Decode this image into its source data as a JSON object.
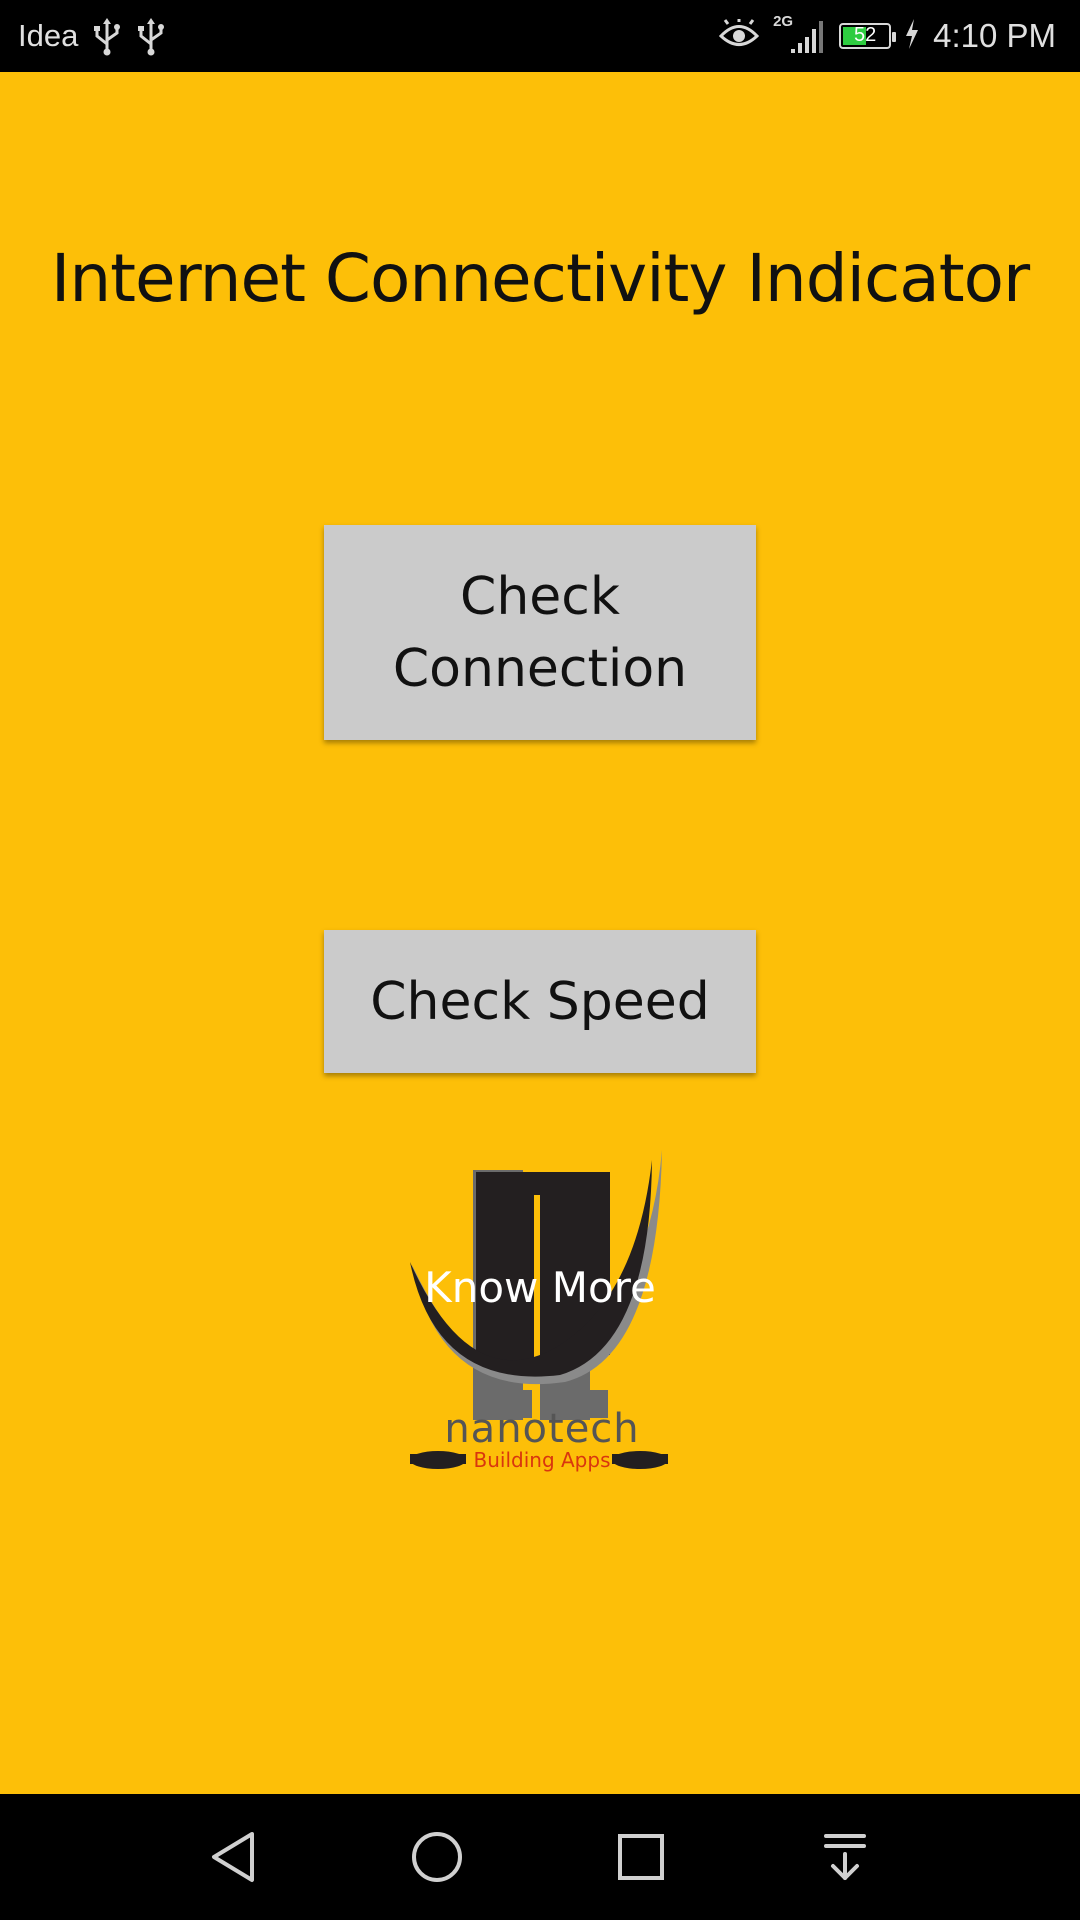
{
  "status_bar": {
    "carrier": "Idea",
    "network_type": "2G",
    "battery_level": "52",
    "battery_fraction": 0.52,
    "time": "4:10 PM",
    "icons": [
      "usb-icon",
      "usb-icon",
      "eye-icon",
      "signal-icon",
      "battery-icon",
      "charging-icon"
    ]
  },
  "main": {
    "title": "Internet Connectivity Indicator",
    "check_connection_label": "Check Connection",
    "check_speed_label": "Check Speed",
    "logo": {
      "know_more_label": "Know More",
      "brand_name": "nanotech",
      "tagline": "Building Apps"
    }
  },
  "nav_bar": {
    "icons": [
      "back-icon",
      "home-icon",
      "recents-icon",
      "notification-pull-icon"
    ]
  },
  "colors": {
    "background": "#FDBF08",
    "button": "#CBCBCB",
    "status_bar": "#000000",
    "tagline": "#D9360E"
  }
}
